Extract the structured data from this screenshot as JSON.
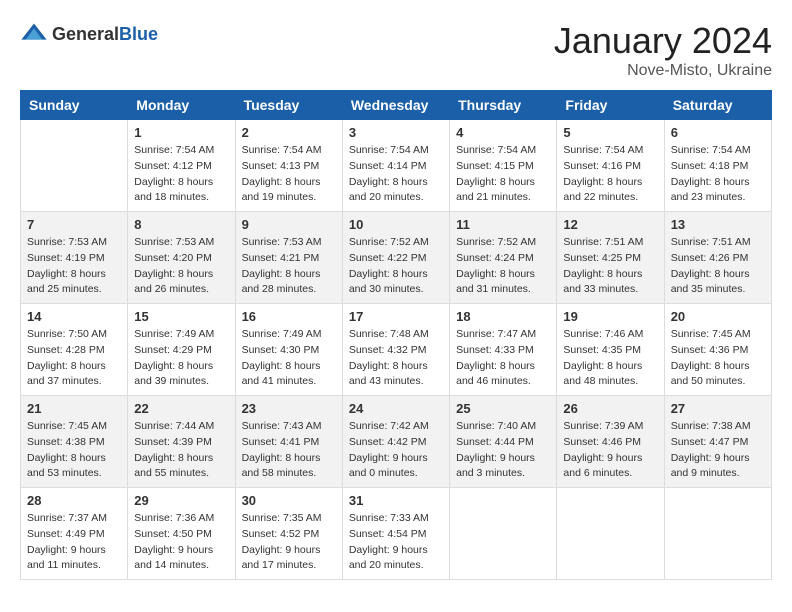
{
  "logo": {
    "general": "General",
    "blue": "Blue"
  },
  "title": "January 2024",
  "location": "Nove-Misto, Ukraine",
  "days_header": [
    "Sunday",
    "Monday",
    "Tuesday",
    "Wednesday",
    "Thursday",
    "Friday",
    "Saturday"
  ],
  "weeks": [
    [
      {
        "day": "",
        "sunrise": "",
        "sunset": "",
        "daylight": ""
      },
      {
        "day": "1",
        "sunrise": "Sunrise: 7:54 AM",
        "sunset": "Sunset: 4:12 PM",
        "daylight": "Daylight: 8 hours and 18 minutes."
      },
      {
        "day": "2",
        "sunrise": "Sunrise: 7:54 AM",
        "sunset": "Sunset: 4:13 PM",
        "daylight": "Daylight: 8 hours and 19 minutes."
      },
      {
        "day": "3",
        "sunrise": "Sunrise: 7:54 AM",
        "sunset": "Sunset: 4:14 PM",
        "daylight": "Daylight: 8 hours and 20 minutes."
      },
      {
        "day": "4",
        "sunrise": "Sunrise: 7:54 AM",
        "sunset": "Sunset: 4:15 PM",
        "daylight": "Daylight: 8 hours and 21 minutes."
      },
      {
        "day": "5",
        "sunrise": "Sunrise: 7:54 AM",
        "sunset": "Sunset: 4:16 PM",
        "daylight": "Daylight: 8 hours and 22 minutes."
      },
      {
        "day": "6",
        "sunrise": "Sunrise: 7:54 AM",
        "sunset": "Sunset: 4:18 PM",
        "daylight": "Daylight: 8 hours and 23 minutes."
      }
    ],
    [
      {
        "day": "7",
        "sunrise": "Sunrise: 7:53 AM",
        "sunset": "Sunset: 4:19 PM",
        "daylight": "Daylight: 8 hours and 25 minutes."
      },
      {
        "day": "8",
        "sunrise": "Sunrise: 7:53 AM",
        "sunset": "Sunset: 4:20 PM",
        "daylight": "Daylight: 8 hours and 26 minutes."
      },
      {
        "day": "9",
        "sunrise": "Sunrise: 7:53 AM",
        "sunset": "Sunset: 4:21 PM",
        "daylight": "Daylight: 8 hours and 28 minutes."
      },
      {
        "day": "10",
        "sunrise": "Sunrise: 7:52 AM",
        "sunset": "Sunset: 4:22 PM",
        "daylight": "Daylight: 8 hours and 30 minutes."
      },
      {
        "day": "11",
        "sunrise": "Sunrise: 7:52 AM",
        "sunset": "Sunset: 4:24 PM",
        "daylight": "Daylight: 8 hours and 31 minutes."
      },
      {
        "day": "12",
        "sunrise": "Sunrise: 7:51 AM",
        "sunset": "Sunset: 4:25 PM",
        "daylight": "Daylight: 8 hours and 33 minutes."
      },
      {
        "day": "13",
        "sunrise": "Sunrise: 7:51 AM",
        "sunset": "Sunset: 4:26 PM",
        "daylight": "Daylight: 8 hours and 35 minutes."
      }
    ],
    [
      {
        "day": "14",
        "sunrise": "Sunrise: 7:50 AM",
        "sunset": "Sunset: 4:28 PM",
        "daylight": "Daylight: 8 hours and 37 minutes."
      },
      {
        "day": "15",
        "sunrise": "Sunrise: 7:49 AM",
        "sunset": "Sunset: 4:29 PM",
        "daylight": "Daylight: 8 hours and 39 minutes."
      },
      {
        "day": "16",
        "sunrise": "Sunrise: 7:49 AM",
        "sunset": "Sunset: 4:30 PM",
        "daylight": "Daylight: 8 hours and 41 minutes."
      },
      {
        "day": "17",
        "sunrise": "Sunrise: 7:48 AM",
        "sunset": "Sunset: 4:32 PM",
        "daylight": "Daylight: 8 hours and 43 minutes."
      },
      {
        "day": "18",
        "sunrise": "Sunrise: 7:47 AM",
        "sunset": "Sunset: 4:33 PM",
        "daylight": "Daylight: 8 hours and 46 minutes."
      },
      {
        "day": "19",
        "sunrise": "Sunrise: 7:46 AM",
        "sunset": "Sunset: 4:35 PM",
        "daylight": "Daylight: 8 hours and 48 minutes."
      },
      {
        "day": "20",
        "sunrise": "Sunrise: 7:45 AM",
        "sunset": "Sunset: 4:36 PM",
        "daylight": "Daylight: 8 hours and 50 minutes."
      }
    ],
    [
      {
        "day": "21",
        "sunrise": "Sunrise: 7:45 AM",
        "sunset": "Sunset: 4:38 PM",
        "daylight": "Daylight: 8 hours and 53 minutes."
      },
      {
        "day": "22",
        "sunrise": "Sunrise: 7:44 AM",
        "sunset": "Sunset: 4:39 PM",
        "daylight": "Daylight: 8 hours and 55 minutes."
      },
      {
        "day": "23",
        "sunrise": "Sunrise: 7:43 AM",
        "sunset": "Sunset: 4:41 PM",
        "daylight": "Daylight: 8 hours and 58 minutes."
      },
      {
        "day": "24",
        "sunrise": "Sunrise: 7:42 AM",
        "sunset": "Sunset: 4:42 PM",
        "daylight": "Daylight: 9 hours and 0 minutes."
      },
      {
        "day": "25",
        "sunrise": "Sunrise: 7:40 AM",
        "sunset": "Sunset: 4:44 PM",
        "daylight": "Daylight: 9 hours and 3 minutes."
      },
      {
        "day": "26",
        "sunrise": "Sunrise: 7:39 AM",
        "sunset": "Sunset: 4:46 PM",
        "daylight": "Daylight: 9 hours and 6 minutes."
      },
      {
        "day": "27",
        "sunrise": "Sunrise: 7:38 AM",
        "sunset": "Sunset: 4:47 PM",
        "daylight": "Daylight: 9 hours and 9 minutes."
      }
    ],
    [
      {
        "day": "28",
        "sunrise": "Sunrise: 7:37 AM",
        "sunset": "Sunset: 4:49 PM",
        "daylight": "Daylight: 9 hours and 11 minutes."
      },
      {
        "day": "29",
        "sunrise": "Sunrise: 7:36 AM",
        "sunset": "Sunset: 4:50 PM",
        "daylight": "Daylight: 9 hours and 14 minutes."
      },
      {
        "day": "30",
        "sunrise": "Sunrise: 7:35 AM",
        "sunset": "Sunset: 4:52 PM",
        "daylight": "Daylight: 9 hours and 17 minutes."
      },
      {
        "day": "31",
        "sunrise": "Sunrise: 7:33 AM",
        "sunset": "Sunset: 4:54 PM",
        "daylight": "Daylight: 9 hours and 20 minutes."
      },
      {
        "day": "",
        "sunrise": "",
        "sunset": "",
        "daylight": ""
      },
      {
        "day": "",
        "sunrise": "",
        "sunset": "",
        "daylight": ""
      },
      {
        "day": "",
        "sunrise": "",
        "sunset": "",
        "daylight": ""
      }
    ]
  ]
}
